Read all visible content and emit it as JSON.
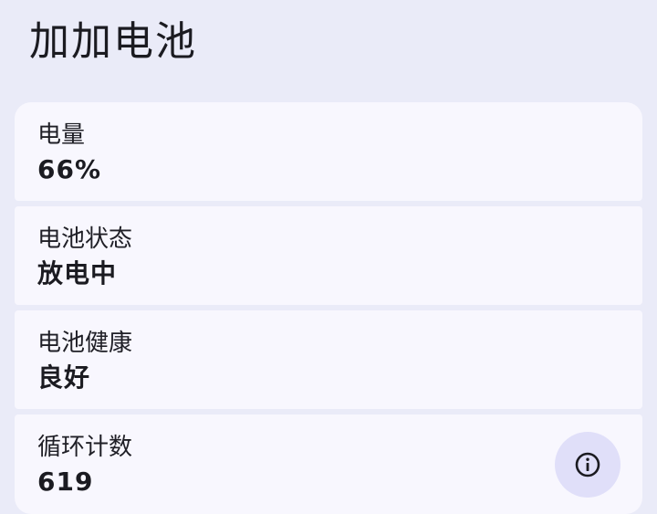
{
  "app": {
    "title": "加加电池"
  },
  "cards": {
    "charge": {
      "label": "电量",
      "value": "66%"
    },
    "status": {
      "label": "电池状态",
      "value": "放电中"
    },
    "health": {
      "label": "电池健康",
      "value": "良好"
    },
    "cycles": {
      "label": "循环计数",
      "value": "619",
      "action_icon": "info-icon"
    }
  },
  "colors": {
    "background": "#eaebf8",
    "card": "#f8f7fe",
    "info_button": "#e0dff9",
    "text": "#1b1b21"
  }
}
